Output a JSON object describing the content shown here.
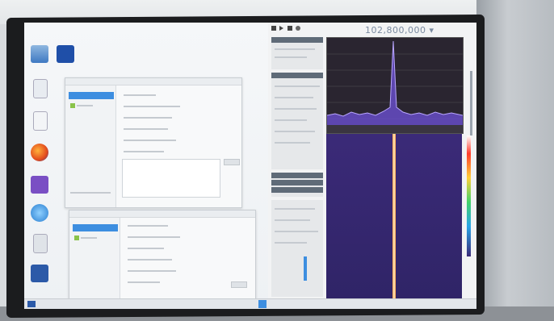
{
  "sdr_app": {
    "frequency_display": "102,800,000 ▾"
  },
  "colors": {
    "waterfall_bg": "#2f2466",
    "signal": "#ffd29a",
    "selection": "#3d8ee0"
  },
  "icons": [
    "recycle-bin-icon",
    "folder-icon",
    "file-icon",
    "firefox-icon",
    "visual-studio-icon",
    "browser-icon",
    "document-icon",
    "computer-icon",
    "image-icon"
  ]
}
